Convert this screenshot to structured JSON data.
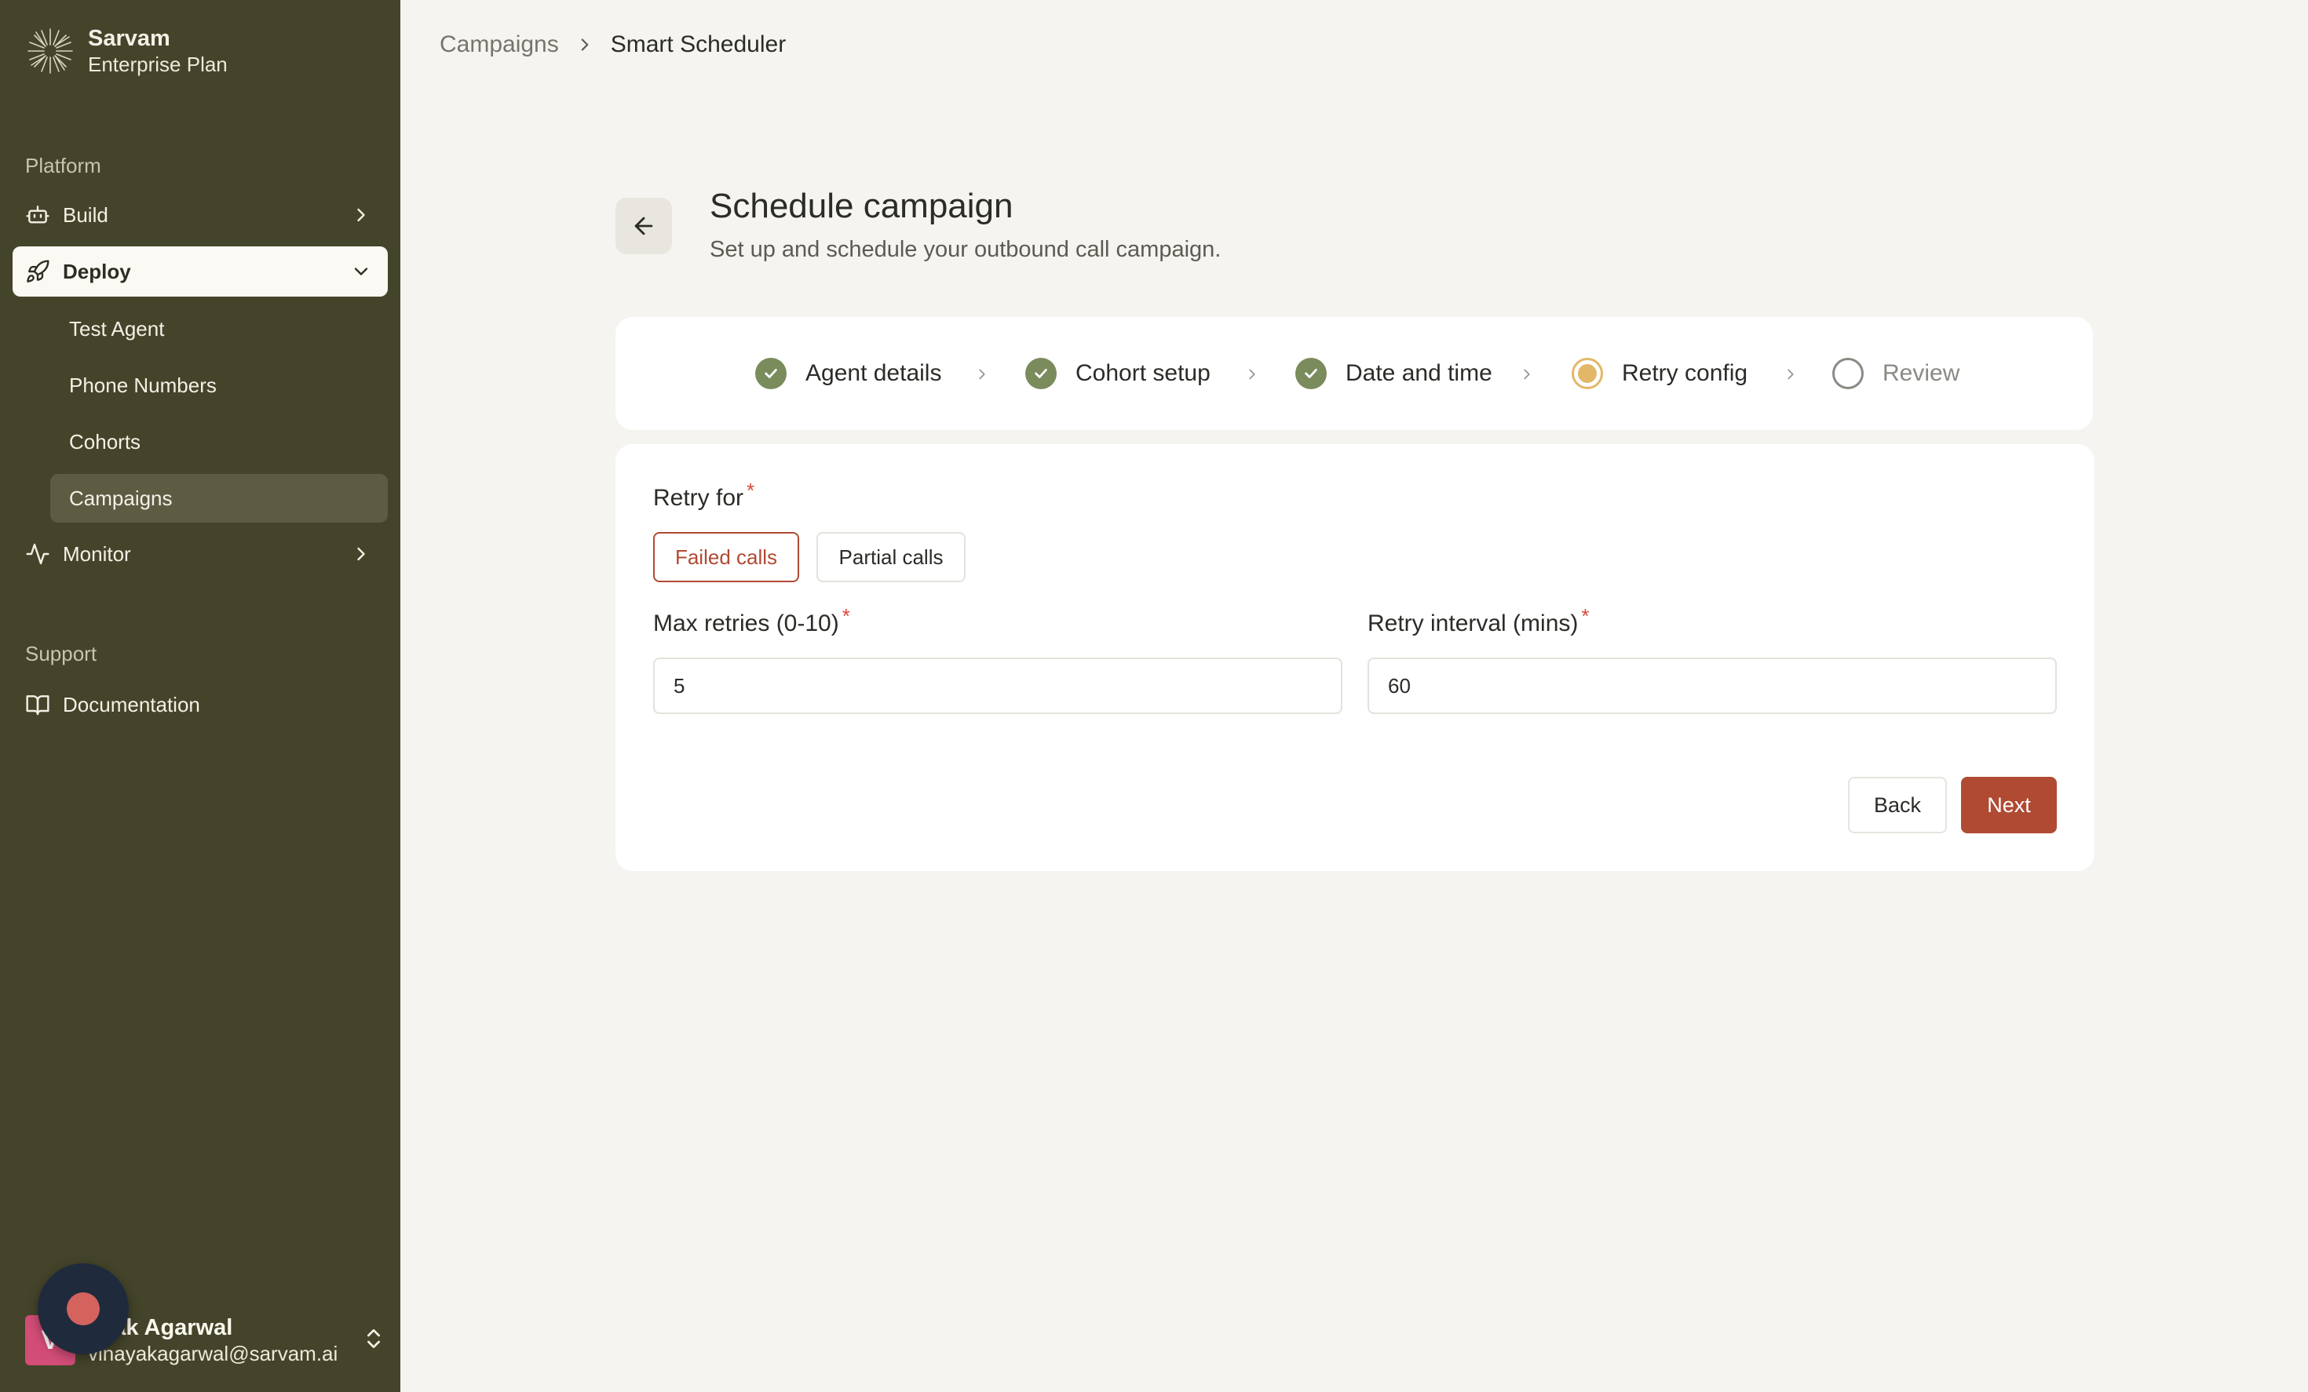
{
  "sidebar": {
    "brand_name": "Sarvam",
    "brand_plan": "Enterprise Plan",
    "platform_label": "Platform",
    "support_label": "Support",
    "nav": {
      "build": "Build",
      "deploy": "Deploy",
      "monitor": "Monitor",
      "documentation": "Documentation"
    },
    "deploy_items": [
      "Test Agent",
      "Phone Numbers",
      "Cohorts",
      "Campaigns"
    ],
    "user": {
      "initial": "V",
      "name": "ayak Agarwal",
      "email": "vinayakagarwal@sarvam.ai"
    }
  },
  "breadcrumb": {
    "parent": "Campaigns",
    "current": "Smart Scheduler"
  },
  "header": {
    "title": "Schedule campaign",
    "subtitle": "Set up and schedule your outbound call campaign."
  },
  "stepper": {
    "steps": [
      {
        "label": "Agent details",
        "status": "done"
      },
      {
        "label": "Cohort setup",
        "status": "done"
      },
      {
        "label": "Date and time",
        "status": "done"
      },
      {
        "label": "Retry config",
        "status": "current"
      },
      {
        "label": "Review",
        "status": "pending"
      }
    ]
  },
  "form": {
    "retry_for_label": "Retry for",
    "retry_options": [
      "Failed calls",
      "Partial calls"
    ],
    "selected_retry_option": "Failed calls",
    "max_retries_label": "Max retries (0-10)",
    "max_retries_value": "5",
    "retry_interval_label": "Retry interval (mins)",
    "retry_interval_value": "60",
    "required_marker": "*"
  },
  "actions": {
    "back_label": "Back",
    "next_label": "Next"
  },
  "colors": {
    "sidebar_bg": "#44442a",
    "accent": "#b04a32",
    "done_step": "#7a8b5c",
    "current_step": "#e2b868",
    "page_bg": "#f5f4f0"
  }
}
